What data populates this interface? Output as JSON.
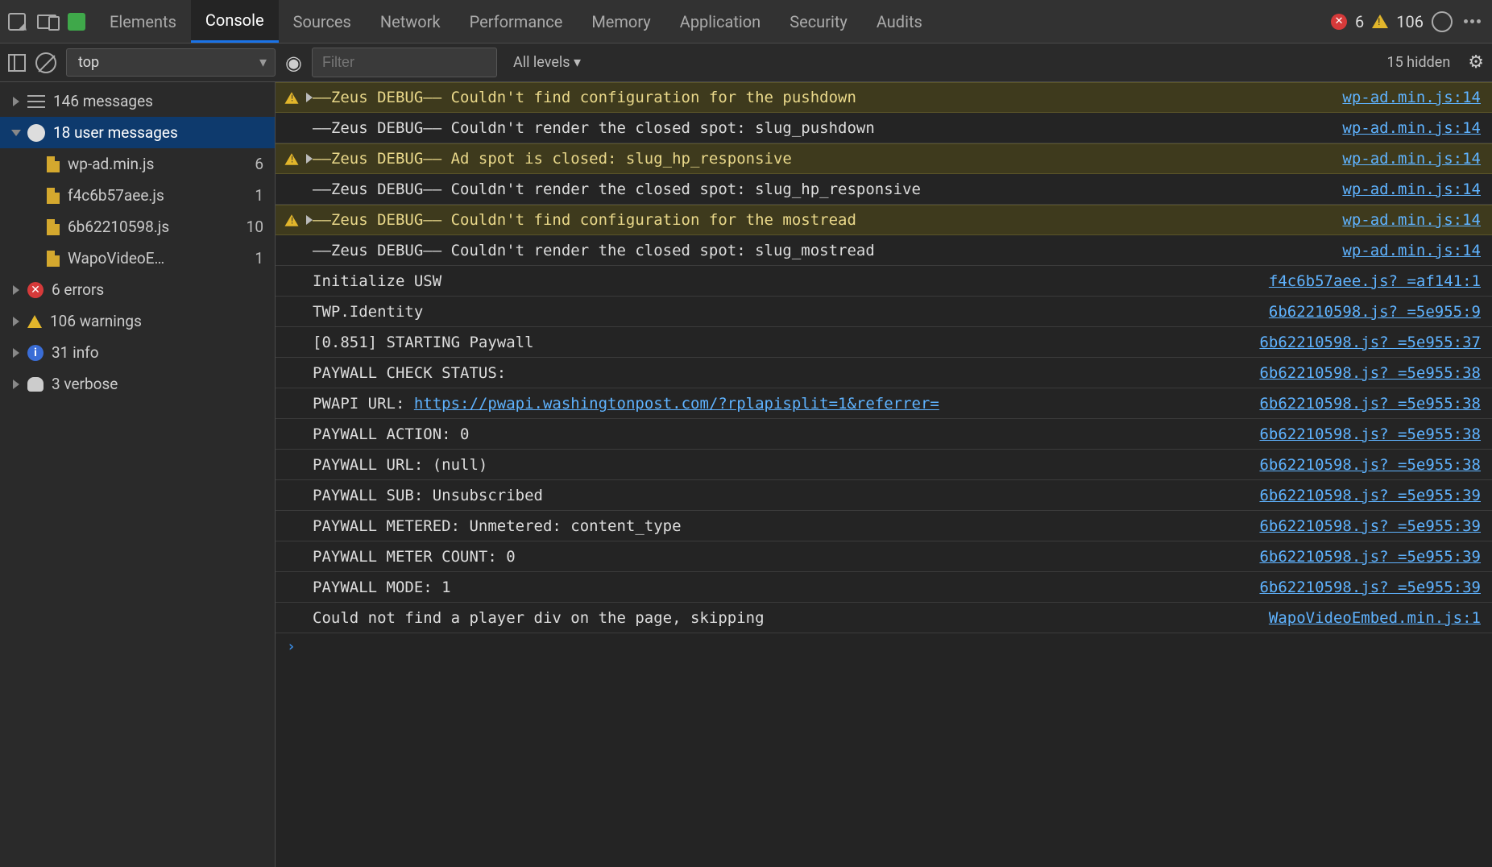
{
  "topbar": {
    "tabs": [
      "Elements",
      "Console",
      "Sources",
      "Network",
      "Performance",
      "Memory",
      "Application",
      "Security",
      "Audits"
    ],
    "active_tab": "Console",
    "error_count": "6",
    "warning_count": "106"
  },
  "toolbar": {
    "context": "top",
    "filter_placeholder": "Filter",
    "levels": "All levels ▾",
    "hidden": "15 hidden"
  },
  "sidebar": {
    "groups": [
      {
        "icon": "list",
        "label": "146 messages",
        "expandable": true,
        "expanded": false,
        "selected": false,
        "count": ""
      },
      {
        "icon": "user",
        "label": "18 user messages",
        "expandable": true,
        "expanded": true,
        "selected": true,
        "count": "",
        "children": [
          {
            "icon": "file",
            "label": "wp-ad.min.js",
            "count": "6"
          },
          {
            "icon": "file",
            "label": "f4c6b57aee.js",
            "count": "1"
          },
          {
            "icon": "file",
            "label": "6b62210598.js",
            "count": "10"
          },
          {
            "icon": "file",
            "label": "WapoVideoE…",
            "count": "1"
          }
        ]
      },
      {
        "icon": "err",
        "label": "6 errors",
        "expandable": true,
        "expanded": false,
        "selected": false,
        "count": ""
      },
      {
        "icon": "warn",
        "label": "106 warnings",
        "expandable": true,
        "expanded": false,
        "selected": false,
        "count": ""
      },
      {
        "icon": "info",
        "label": "31 info",
        "expandable": true,
        "expanded": false,
        "selected": false,
        "count": ""
      },
      {
        "icon": "bug",
        "label": "3 verbose",
        "expandable": true,
        "expanded": false,
        "selected": false,
        "count": ""
      }
    ]
  },
  "console": {
    "rows": [
      {
        "level": "warn",
        "expand": true,
        "msg": "——Zeus DEBUG—— Couldn't find configuration for the pushdown",
        "src": "wp-ad.min.js:14"
      },
      {
        "level": "log",
        "msg": "——Zeus DEBUG—— Couldn't render the closed spot: slug_pushdown",
        "src": "wp-ad.min.js:14"
      },
      {
        "level": "warn",
        "expand": true,
        "msg": "——Zeus DEBUG—— Ad spot is closed: slug_hp_responsive",
        "src": "wp-ad.min.js:14"
      },
      {
        "level": "log",
        "msg": "——Zeus DEBUG—— Couldn't render the closed spot: slug_hp_responsive",
        "src": "wp-ad.min.js:14"
      },
      {
        "level": "warn",
        "expand": true,
        "msg": "——Zeus DEBUG—— Couldn't find configuration for the mostread",
        "src": "wp-ad.min.js:14"
      },
      {
        "level": "log",
        "msg": "——Zeus DEBUG—— Couldn't render the closed spot: slug_mostread",
        "src": "wp-ad.min.js:14"
      },
      {
        "level": "log",
        "msg": "Initialize USW",
        "src": "f4c6b57aee.js? =af141:1"
      },
      {
        "level": "log",
        "msg": "TWP.Identity",
        "src": "6b62210598.js? =5e955:9"
      },
      {
        "level": "log",
        "msg": "[0.851] STARTING Paywall",
        "src": "6b62210598.js? =5e955:37"
      },
      {
        "level": "log",
        "msg": "PAYWALL CHECK STATUS:",
        "src": "6b62210598.js? =5e955:38"
      },
      {
        "level": "log",
        "msg": "PWAPI URL: ",
        "link": "https://pwapi.washingtonpost.com/?rplapisplit=1&referrer=",
        "src": "6b62210598.js? =5e955:38"
      },
      {
        "level": "log",
        "msg": "PAYWALL ACTION: 0",
        "src": "6b62210598.js? =5e955:38"
      },
      {
        "level": "log",
        "msg": "PAYWALL URL: (null)",
        "src": "6b62210598.js? =5e955:38"
      },
      {
        "level": "log",
        "msg": "PAYWALL SUB: Unsubscribed",
        "src": "6b62210598.js? =5e955:39"
      },
      {
        "level": "log",
        "msg": "PAYWALL METERED: Unmetered: content_type",
        "src": "6b62210598.js? =5e955:39"
      },
      {
        "level": "log",
        "msg": "PAYWALL METER COUNT: 0",
        "src": "6b62210598.js? =5e955:39"
      },
      {
        "level": "log",
        "msg": "PAYWALL MODE: 1",
        "src": "6b62210598.js? =5e955:39"
      },
      {
        "level": "log",
        "msg": "Could not find a player div on the page, skipping",
        "src": "WapoVideoEmbed.min.js:1"
      }
    ]
  }
}
